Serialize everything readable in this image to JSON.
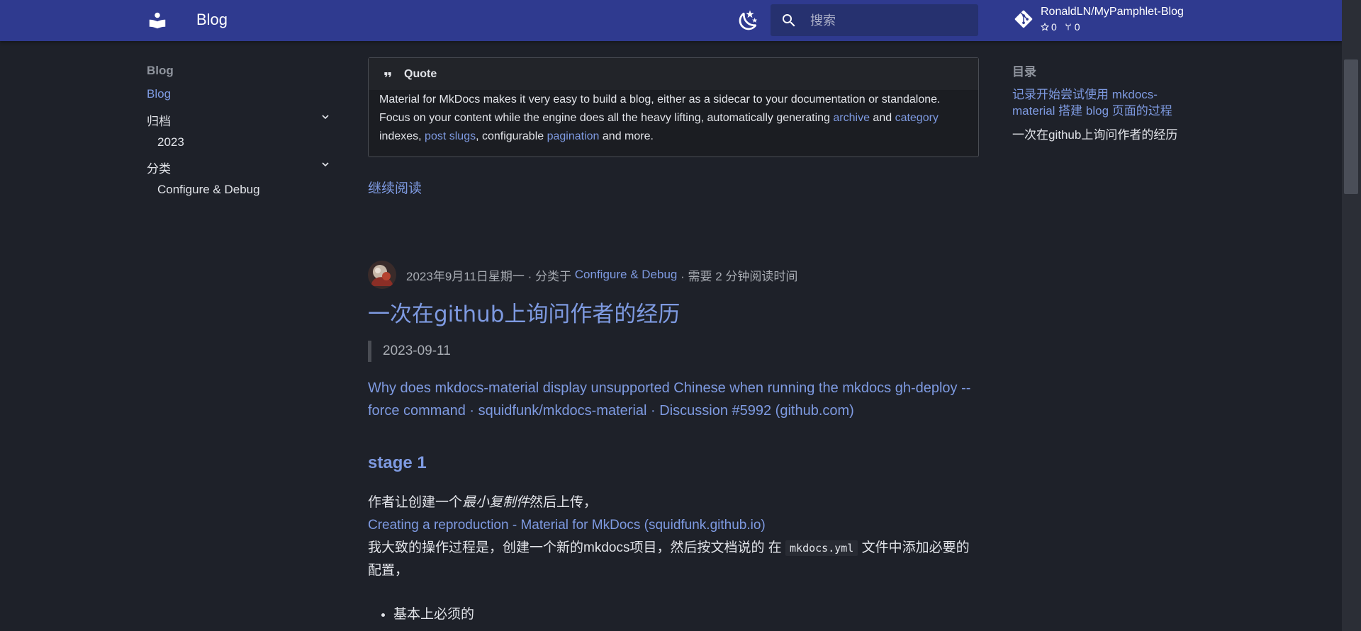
{
  "header": {
    "site_title": "Blog",
    "search_placeholder": "搜索",
    "repo_name": "RonaldLN/MyPamphlet-Blog",
    "stars": "0",
    "forks": "0",
    "brand_color": "#2f3a8f"
  },
  "nav": {
    "title": "Blog",
    "items": [
      {
        "label": "Blog",
        "active": true
      },
      {
        "label": "归档",
        "expandable": true
      },
      {
        "label": "2023"
      },
      {
        "label": "分类",
        "expandable": true
      },
      {
        "label": "Configure & Debug"
      }
    ]
  },
  "toc": {
    "title": "目录",
    "items": [
      {
        "label": "记录开始尝试使用 mkdocs-material 搭建 blog 页面的过程",
        "active": true
      },
      {
        "label": "一次在github上询问作者的经历"
      }
    ]
  },
  "quote": {
    "label": "Quote",
    "text_1": "Material for MkDocs makes it very easy to build a blog, either as a sidecar to your documentation or standalone. Focus on your content while the engine does all the heavy lifting, automatically generating ",
    "link_archive": "archive",
    "text_2": " and ",
    "link_category": "category",
    "text_3": " indexes, ",
    "link_post_slugs": "post slugs",
    "text_4": ", configurable ",
    "link_pagination": "pagination",
    "text_5": " and more."
  },
  "read_more": "继续阅读",
  "post": {
    "meta_date": "2023年9月11日星期一",
    "meta_sep_1": " · 分类于 ",
    "meta_category": "Configure & Debug",
    "meta_sep_2": " · 需要 2 分钟阅读时间",
    "title": "一次在github上询问作者的经历",
    "date_quote": "2023-09-11",
    "github_link": "Why does mkdocs-material display unsupported Chinese when running the mkdocs gh-deploy --force command · squidfunk/mkdocs-material · Discussion #5992 (github.com)",
    "stage_heading": "stage 1",
    "para_1a": "作者让创建一个",
    "para_1_em": "最小复制件",
    "para_1b": "然后上传，",
    "repro_link": "Creating a reproduction - Material for MkDocs (squidfunk.github.io)",
    "para_2a": "我大致的操作过程是，创建一个新的mkdocs项目，然后按文档说的 在 ",
    "para_2_code": "mkdocs.yml",
    "para_2b": " 文件中添加必要的配置，",
    "bullet_1": "基本上必须的"
  }
}
